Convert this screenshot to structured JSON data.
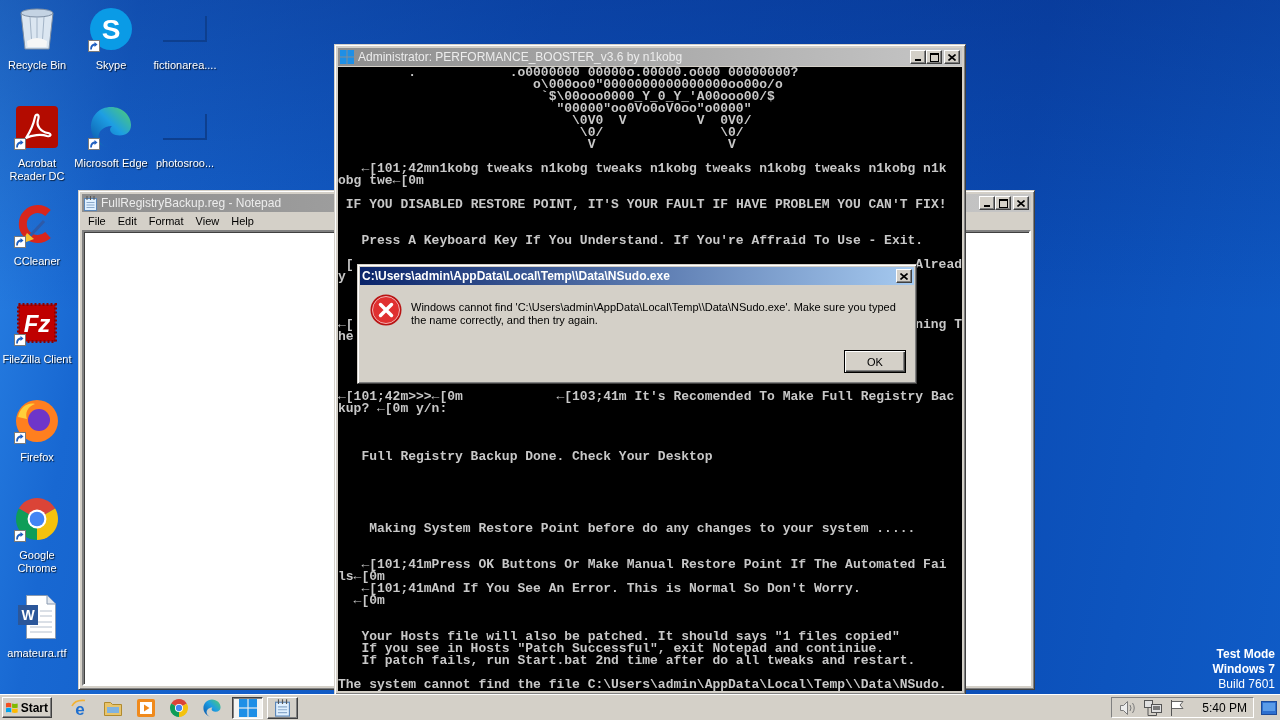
{
  "desktop": {
    "icon_columns": [
      [
        {
          "label": "Recycle Bin",
          "kind": "bin",
          "shortcut": false
        },
        {
          "label": "Acrobat Reader DC",
          "kind": "acrobat",
          "shortcut": true
        },
        {
          "label": "CCleaner",
          "kind": "ccleaner",
          "shortcut": true
        },
        {
          "label": "FileZilla Client",
          "kind": "filezilla",
          "glyph": "Fz",
          "shortcut": true
        },
        {
          "label": "Firefox",
          "kind": "firefox",
          "shortcut": true
        },
        {
          "label": "Google Chrome",
          "kind": "chrome",
          "shortcut": true
        },
        {
          "label": "amateura.rtf",
          "kind": "document",
          "glyph": "W",
          "shortcut": false
        }
      ],
      [
        {
          "label": "Skype",
          "kind": "skype",
          "glyph": "S",
          "shortcut": true
        },
        {
          "label": "Microsoft Edge",
          "kind": "edge",
          "shortcut": true
        }
      ],
      [
        {
          "label": "fictionarea....",
          "kind": "blank",
          "shortcut": false
        },
        {
          "label": "photosroo...",
          "kind": "blank",
          "shortcut": false
        }
      ]
    ],
    "notice": [
      "Test Mode",
      "Windows 7",
      "Build 7601"
    ]
  },
  "notepad": {
    "title": "FullRegistryBackup.reg - Notepad",
    "active": false,
    "menu": [
      "File",
      "Edit",
      "Format",
      "View",
      "Help"
    ]
  },
  "console": {
    "title": "Administrator: PERFORMANCE_BOOSTER_v3.6 by n1kobg",
    "active": false,
    "lines": [
      {
        "kind": "text",
        "text": "         .            .o0000000 00000o.00000.o000 00000000?"
      },
      {
        "kind": "text",
        "text": "                         o\\000oo0\"0000000000000000oo00o/o"
      },
      {
        "kind": "text",
        "text": "                          `$\\00ooo0000_Y_0_Y_'A00ooo00/$"
      },
      {
        "kind": "text",
        "text": "                            \"00000\"oo0Vo0oV0oo\"o0000\""
      },
      {
        "kind": "text",
        "text": "                              \\0V0  V         V  0V0/"
      },
      {
        "kind": "text",
        "text": "                               \\0/               \\0/"
      },
      {
        "kind": "text",
        "text": "                                V                 V"
      },
      {
        "kind": "blank"
      },
      {
        "kind": "text",
        "text": "   ←[101;42mn1kobg tweaks n1kobg tweaks n1kobg tweaks n1kobg tweaks n1kobg n1k"
      },
      {
        "kind": "text",
        "text": "obg twe←[0m"
      },
      {
        "kind": "blank"
      },
      {
        "kind": "text",
        "text": " IF YOU DISABLED RESTORE POINT, IT'S YOUR FAULT IF HAVE PROBLEM YOU CAN'T FIX!"
      },
      {
        "kind": "blank"
      },
      {
        "kind": "blank"
      },
      {
        "kind": "text",
        "text": "   Press A Keyboard Key If You Understand. If You're Affraid To Use - Exit."
      },
      {
        "kind": "blank"
      },
      {
        "kind": "split",
        "start": " [",
        "end": "Alread"
      },
      {
        "kind": "text",
        "text": "y"
      },
      {
        "kind": "blank"
      },
      {
        "kind": "blank"
      },
      {
        "kind": "blank"
      },
      {
        "kind": "split",
        "start": "←[",
        "end": "ning T"
      },
      {
        "kind": "text",
        "text": "he"
      },
      {
        "kind": "blank"
      },
      {
        "kind": "blank"
      },
      {
        "kind": "blank"
      },
      {
        "kind": "blank"
      },
      {
        "kind": "text",
        "text": "←[101;42m>>>←[0m            ←[103;41m It's Recomended To Make Full Registry Bac"
      },
      {
        "kind": "text",
        "text": "kup? ←[0m y/n:"
      },
      {
        "kind": "blank"
      },
      {
        "kind": "blank"
      },
      {
        "kind": "blank"
      },
      {
        "kind": "text",
        "text": "   Full Registry Backup Done. Check Your Desktop"
      },
      {
        "kind": "blank"
      },
      {
        "kind": "blank"
      },
      {
        "kind": "blank"
      },
      {
        "kind": "blank"
      },
      {
        "kind": "blank"
      },
      {
        "kind": "text",
        "text": "    Making System Restore Point before do any changes to your system ....."
      },
      {
        "kind": "blank"
      },
      {
        "kind": "blank"
      },
      {
        "kind": "text",
        "text": "   ←[101;41mPress OK Buttons Or Make Manual Restore Point If The Automated Fai"
      },
      {
        "kind": "text",
        "text": "ls←[0m"
      },
      {
        "kind": "text",
        "text": "   ←[101;41mAnd If You See An Error. This is Normal So Don't Worry."
      },
      {
        "kind": "text",
        "text": "  ←[0m"
      },
      {
        "kind": "blank"
      },
      {
        "kind": "blank"
      },
      {
        "kind": "text",
        "text": "   Your Hosts file will also be patched. It should says \"1 files copied\""
      },
      {
        "kind": "text",
        "text": "   If you see in Hosts \"Patch Successful\", exit Notepad and continiue."
      },
      {
        "kind": "text",
        "text": "   If patch fails, run Start.bat 2nd time after do all tweaks and restart."
      },
      {
        "kind": "blank"
      },
      {
        "kind": "text",
        "text": "The system cannot find the file C:\\Users\\admin\\AppData\\Local\\Temp\\\\Data\\NSudo."
      }
    ]
  },
  "dialog": {
    "title": "C:\\Users\\admin\\AppData\\Local\\Temp\\\\Data\\NSudo.exe",
    "active": true,
    "message": "Windows cannot find 'C:\\Users\\admin\\AppData\\Local\\Temp\\\\Data\\NSudo.exe'. Make sure you typed the name correctly, and then try again.",
    "buttons": [
      "OK"
    ]
  },
  "taskbar": {
    "start": "Start",
    "quick_launch": [
      {
        "kind": "ie",
        "glyph": "e"
      },
      {
        "kind": "folder"
      },
      {
        "kind": "media"
      },
      {
        "kind": "chrome"
      },
      {
        "kind": "edge"
      }
    ],
    "tasks": [
      {
        "kind": "console",
        "selected": true
      },
      {
        "kind": "notepad",
        "selected": false
      }
    ],
    "clock": "5:40 PM"
  }
}
